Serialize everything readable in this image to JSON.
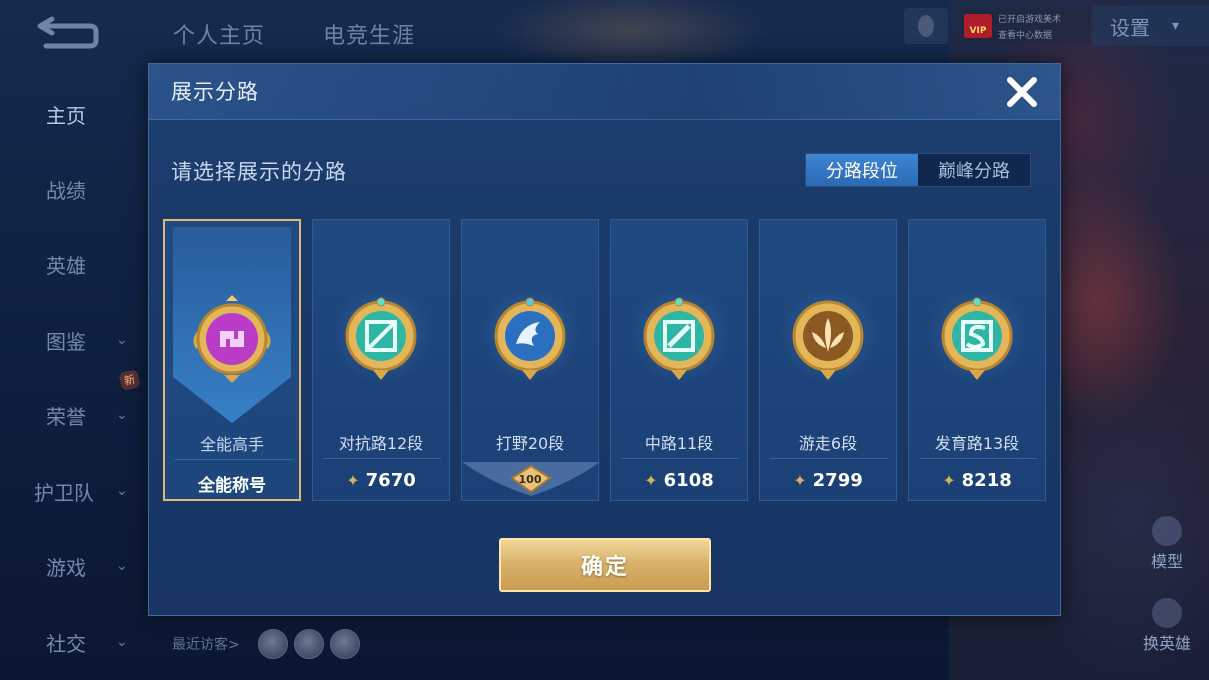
{
  "top_bar": {
    "tabs": [
      "个人主页",
      "电竞生涯"
    ],
    "settings_label": "设置",
    "vip_lines": [
      "已开启游戏美术",
      "查看中心数据"
    ],
    "vip_label": "VIP"
  },
  "sidebar": {
    "items": [
      {
        "label": "主页",
        "has_chevron": false
      },
      {
        "label": "战绩",
        "has_chevron": false
      },
      {
        "label": "英雄",
        "has_chevron": false
      },
      {
        "label": "图鉴",
        "has_chevron": true
      },
      {
        "label": "荣誉",
        "has_chevron": true
      },
      {
        "label": "护卫队",
        "has_chevron": true
      },
      {
        "label": "游戏",
        "has_chevron": true
      },
      {
        "label": "社交",
        "has_chevron": true
      }
    ],
    "new_badge": "新"
  },
  "visitors": {
    "label": "最近访客>"
  },
  "right_buttons": {
    "model": "模型",
    "switch_hero": "换英雄"
  },
  "modal": {
    "title": "展示分路",
    "close_label": "✕",
    "subtitle": "请选择展示的分路",
    "segments": [
      {
        "label": "分路段位",
        "active": true
      },
      {
        "label": "巅峰分路",
        "active": false
      }
    ],
    "cards": [
      {
        "rank": "全能高手",
        "bottom": "全能称号",
        "type": "title",
        "color": "#c24fd0",
        "icon": "allround-medal-icon"
      },
      {
        "rank": "对抗路12段",
        "score": "7670",
        "type": "score",
        "color": "#2fb5a3",
        "icon": "clash-lane-medal-icon"
      },
      {
        "rank": "打野20段",
        "level": "100",
        "type": "level",
        "color": "#2a6fc0",
        "icon": "jungle-medal-icon"
      },
      {
        "rank": "中路11段",
        "score": "6108",
        "type": "score",
        "color": "#2fb5a3",
        "icon": "mid-lane-medal-icon"
      },
      {
        "rank": "游走6段",
        "score": "2799",
        "type": "score",
        "color": "#c98a3a",
        "icon": "roam-medal-icon"
      },
      {
        "rank": "发育路13段",
        "score": "8218",
        "type": "score",
        "color": "#2fb5a3",
        "icon": "farm-lane-medal-icon"
      }
    ],
    "confirm_label": "确定"
  }
}
